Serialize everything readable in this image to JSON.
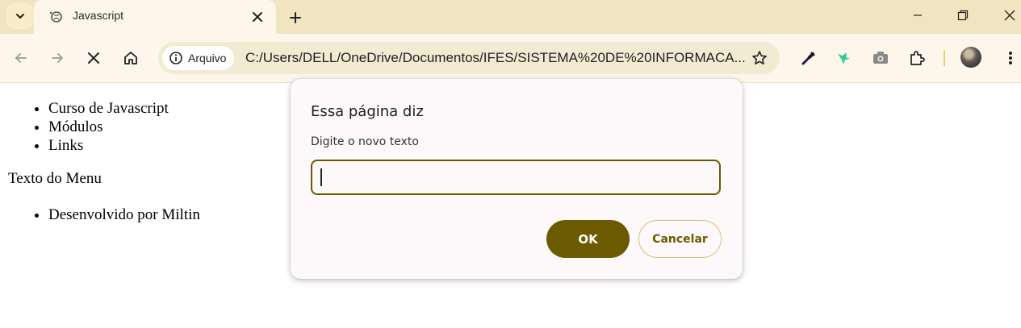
{
  "tab": {
    "title": "Javascript"
  },
  "omnibox": {
    "security_label": "Arquivo",
    "url": "C:/Users/DELL/OneDrive/Documentos/IFES/SISTEMA%20DE%20INFORMACA..."
  },
  "page": {
    "menu_items": [
      "Curso de Javascript",
      "Módulos",
      "Links"
    ],
    "menu_text": "Texto do Menu",
    "footer_items": [
      "Desenvolvido por Miltin"
    ]
  },
  "dialog": {
    "title": "Essa página diz",
    "message": "Digite o novo texto",
    "input_value": "",
    "ok_label": "OK",
    "cancel_label": "Cancelar"
  },
  "colors": {
    "accent": "#6b5a00",
    "tabstrip": "#f0e5c0",
    "toolbar": "#fcf7ea",
    "extension_green": "#2ecc9a"
  }
}
